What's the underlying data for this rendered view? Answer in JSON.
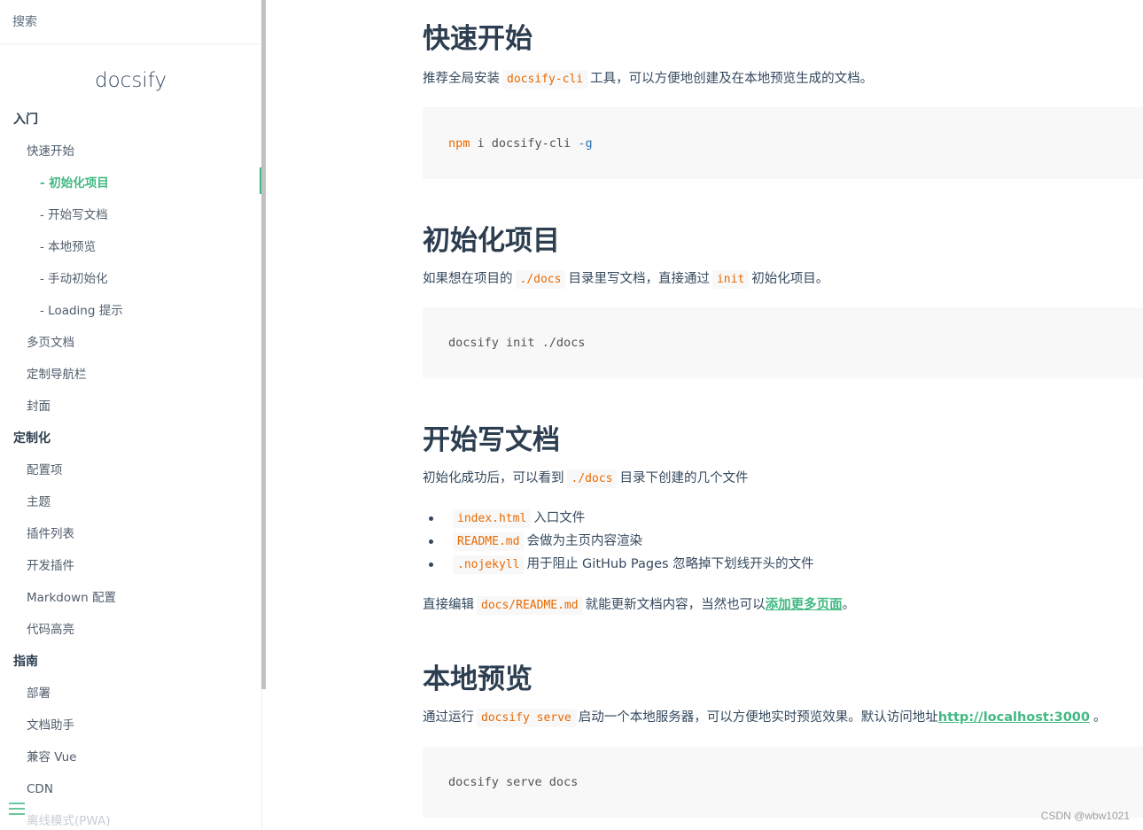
{
  "sidebar": {
    "search_placeholder": "搜索",
    "app_name": "docsify",
    "nav": [
      {
        "label": "入门",
        "level": "sec"
      },
      {
        "label": "快速开始",
        "level": "l1"
      },
      {
        "label": "- 初始化项目",
        "level": "l2",
        "active": true
      },
      {
        "label": "- 开始写文档",
        "level": "l2"
      },
      {
        "label": "- 本地预览",
        "level": "l2"
      },
      {
        "label": "- 手动初始化",
        "level": "l2"
      },
      {
        "label": "- Loading 提示",
        "level": "l2"
      },
      {
        "label": "多页文档",
        "level": "l1"
      },
      {
        "label": "定制导航栏",
        "level": "l1"
      },
      {
        "label": "封面",
        "level": "l1"
      },
      {
        "label": "定制化",
        "level": "sec"
      },
      {
        "label": "配置项",
        "level": "l1"
      },
      {
        "label": "主题",
        "level": "l1"
      },
      {
        "label": "插件列表",
        "level": "l1"
      },
      {
        "label": "开发插件",
        "level": "l1"
      },
      {
        "label": "Markdown 配置",
        "level": "l1"
      },
      {
        "label": "代码高亮",
        "level": "l1"
      },
      {
        "label": "指南",
        "level": "sec"
      },
      {
        "label": "部署",
        "level": "l1"
      },
      {
        "label": "文档助手",
        "level": "l1"
      },
      {
        "label": "兼容 Vue",
        "level": "l1"
      },
      {
        "label": "CDN",
        "level": "l1"
      },
      {
        "label": "离线模式(PWA)",
        "level": "l1",
        "faded": true
      }
    ]
  },
  "main": {
    "s1": {
      "title": "快速开始",
      "p_before": "推荐全局安装",
      "p_code": "docsify-cli",
      "p_after": "工具，可以方便地创建及在本地预览生成的文档。",
      "code_cmd": "npm",
      "code_mid": " i docsify-cli ",
      "code_flag": "-g"
    },
    "s2": {
      "title": "初始化项目",
      "p_1": "如果想在项目的",
      "p_code1": "./docs",
      "p_2": "目录里写文档，直接通过",
      "p_code2": "init",
      "p_3": "初始化项目。",
      "code": "docsify init ./docs"
    },
    "s3": {
      "title": "开始写文档",
      "p_1": "初始化成功后，可以看到",
      "p_code": "./docs",
      "p_2": "目录下创建的几个文件",
      "list": [
        {
          "code": "index.html",
          "text": "入口文件"
        },
        {
          "code": "README.md",
          "text": "会做为主页内容渲染"
        },
        {
          "code": ".nojekyll",
          "text": "用于阻止 GitHub Pages 忽略掉下划线开头的文件"
        }
      ],
      "p2_1": "直接编辑",
      "p2_code": "docs/README.md",
      "p2_2": "就能更新文档内容，当然也可以",
      "p2_link": "添加更多页面",
      "p2_3": "。"
    },
    "s4": {
      "title": "本地预览",
      "p_1": "通过运行",
      "p_code": "docsify serve",
      "p_2": "启动一个本地服务器，可以方便地实时预览效果。默认访问地址",
      "p_link": "http://localhost:3000",
      "p_3": "。",
      "code": "docsify serve docs"
    }
  },
  "watermark": "CSDN @wbw1021",
  "colors": {
    "accent": "#42b983",
    "code": "#e96900",
    "text": "#34495e",
    "heading": "#2c3e50"
  }
}
